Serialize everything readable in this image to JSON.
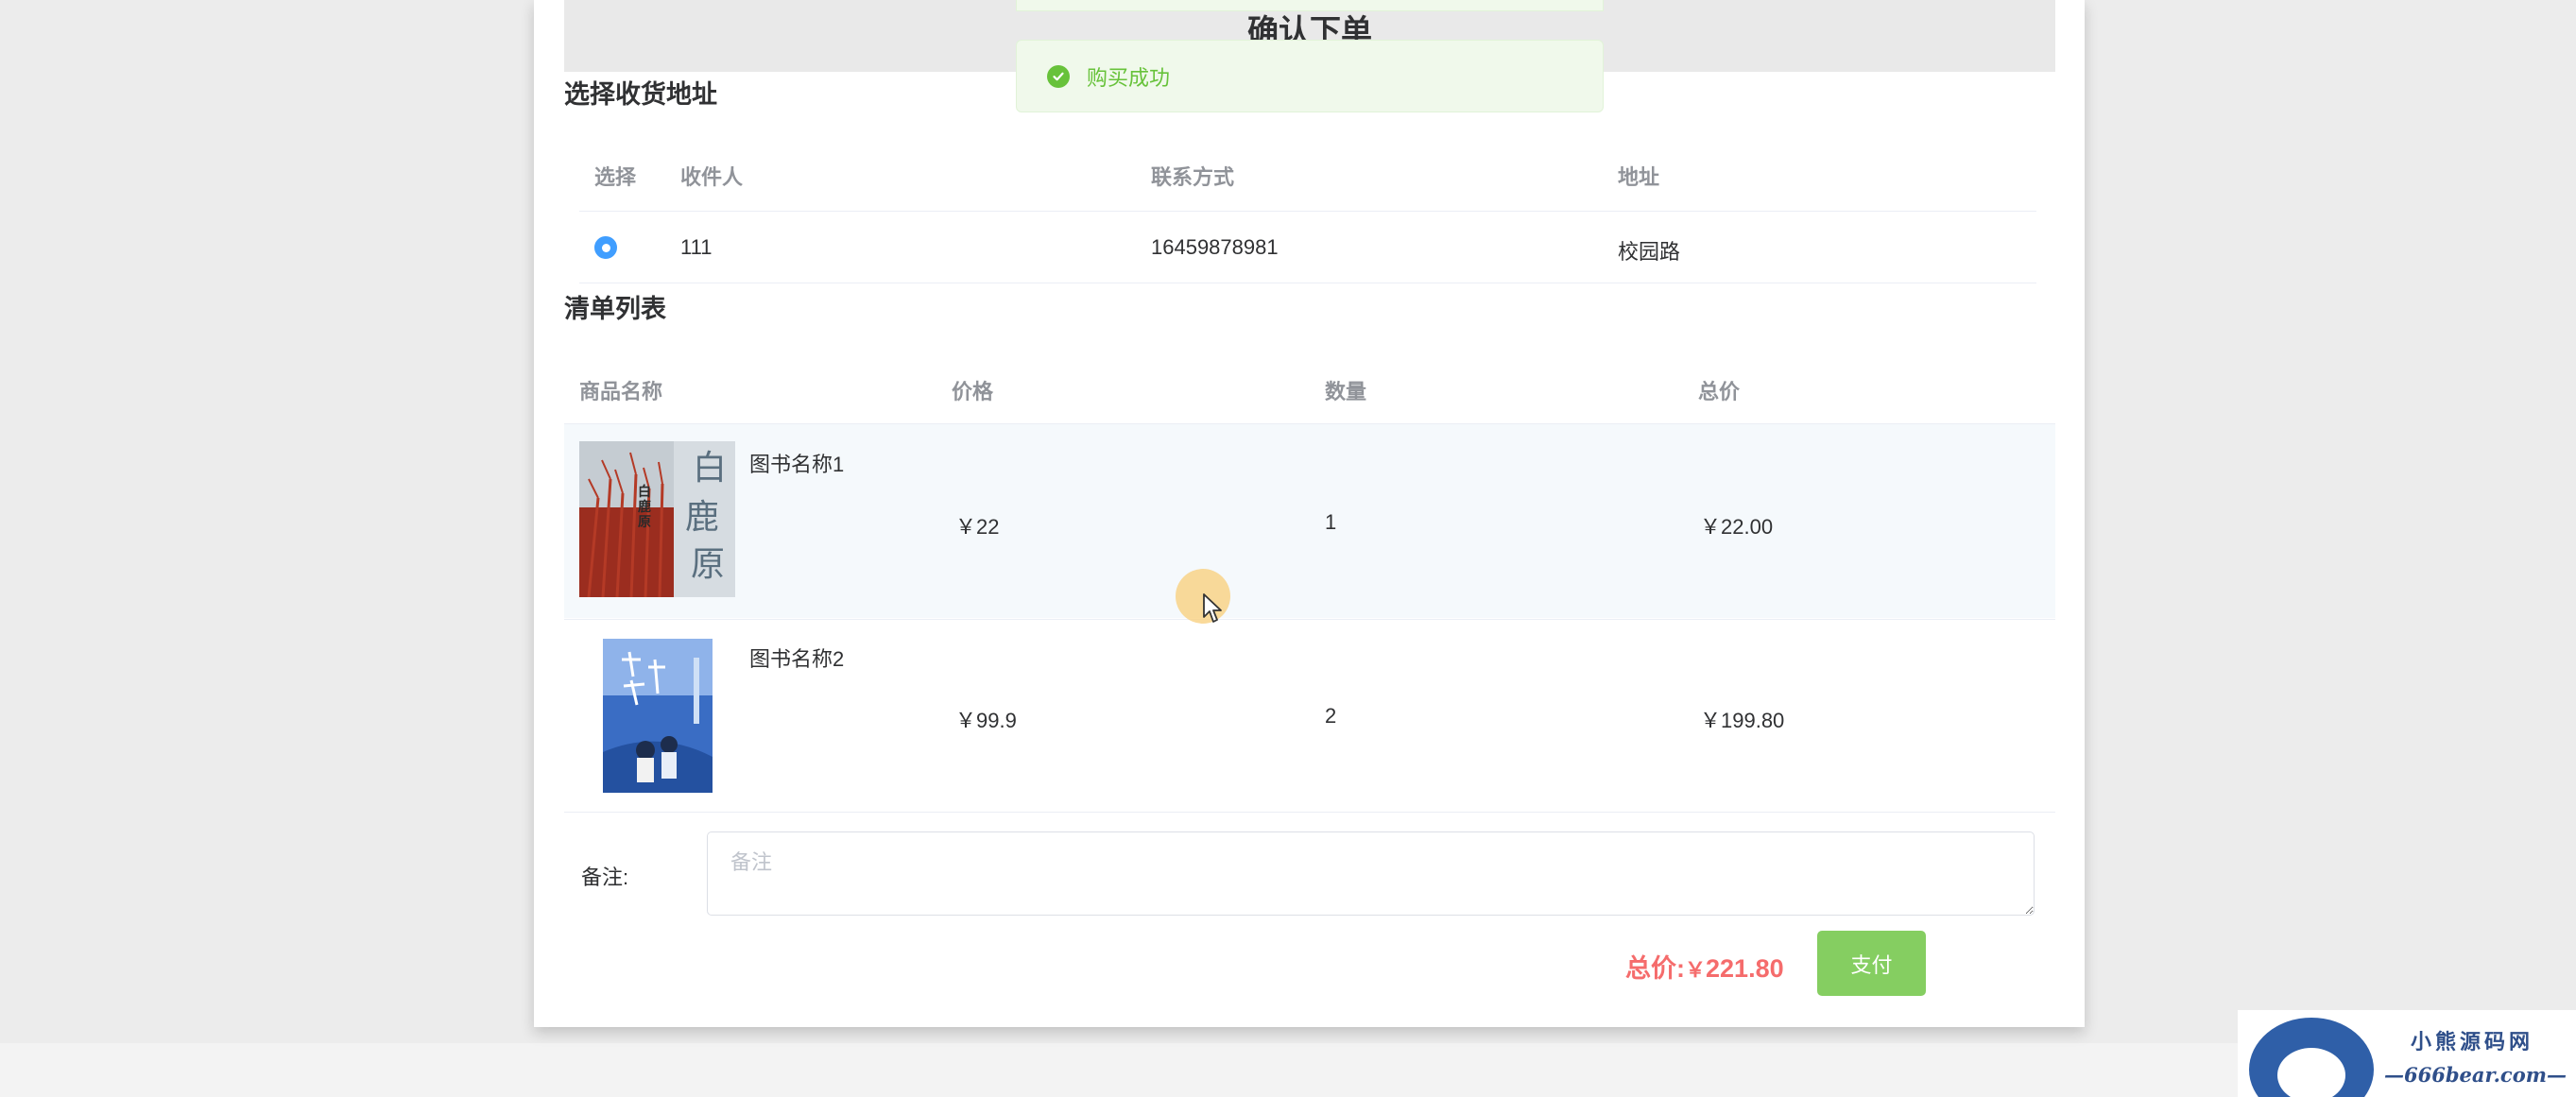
{
  "page": {
    "title": "确认下单"
  },
  "toast": {
    "message": "购买成功",
    "icon": "check-circle-icon",
    "color": "#67c23a"
  },
  "address_section": {
    "title": "选择收货地址",
    "headers": {
      "select": "选择",
      "recipient": "收件人",
      "contact": "联系方式",
      "address": "地址"
    },
    "rows": [
      {
        "selected": true,
        "recipient": "111",
        "contact": "16459878981",
        "address": "校园路"
      }
    ]
  },
  "order_section": {
    "title": "清单列表",
    "headers": {
      "name": "商品名称",
      "price": "价格",
      "quantity": "数量",
      "subtotal": "总价"
    },
    "items": [
      {
        "name": "图书名称1",
        "price": "￥22",
        "quantity": "1",
        "subtotal": "￥22.00",
        "cover_text": "白鹿原"
      },
      {
        "name": "图书名称2",
        "price": "￥99.9",
        "quantity": "2",
        "subtotal": "￥199.80"
      }
    ]
  },
  "remark": {
    "label": "备注:",
    "placeholder": "备注",
    "value": ""
  },
  "summary": {
    "total_label": "总价:",
    "currency": "￥",
    "total_value": "221.80",
    "pay_label": "支付"
  },
  "watermark": {
    "text_cn": "小熊源码网",
    "text_en": "—666bear.com—"
  },
  "colors": {
    "accent": "#409eff",
    "success": "#67c23a",
    "pay_button": "#85ce61",
    "total": "#f56c6c"
  }
}
